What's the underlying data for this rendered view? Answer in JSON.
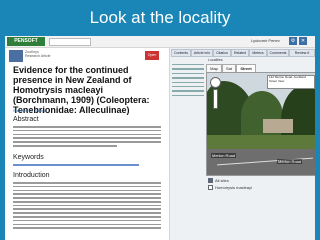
{
  "slide": {
    "title": "Look at the locality"
  },
  "site": {
    "logo": "PENSOFT",
    "user": "Lyubomir Penev"
  },
  "article": {
    "badge": "Open Access",
    "meta_lines": [
      "ZooKeys",
      "Research Article"
    ],
    "title": "Evidence for the continued presence in New Zealand of Homotrysis macleayi (Borchmann, 1909) (Coleoptera: Tenebrionidae: Alleculinae)",
    "author": "Stephen E. Thorpe",
    "sections": [
      "Abstract",
      "Keywords",
      "Introduction"
    ]
  },
  "panel": {
    "tabs": [
      "Contents",
      "Article info",
      "Citation",
      "Related",
      "Metrics",
      "Comments",
      "Review #"
    ],
    "row2": "Localities",
    "map_tabs": [
      "Map",
      "Sat",
      "Street"
    ],
    "info_lines": [
      "142 Merton Road, Auckland",
      "Street View"
    ],
    "road_labels": [
      "Merton Road",
      "Merton Road"
    ],
    "options": [
      "All sites",
      "Homotrysis macleayi"
    ]
  },
  "colors": {
    "slide_bg": "#1a86b8",
    "logo_green": "#2f7f3a"
  }
}
